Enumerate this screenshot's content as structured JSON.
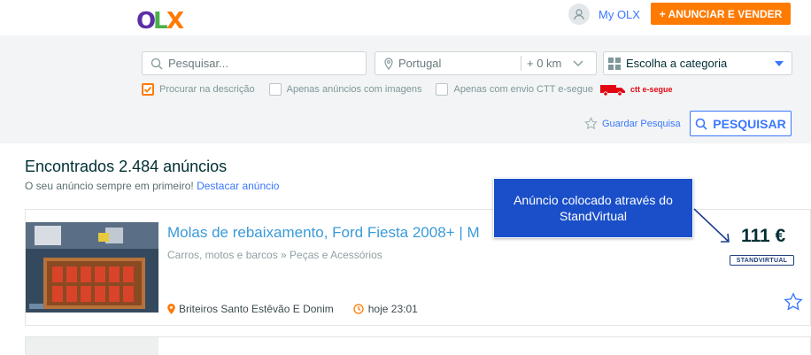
{
  "header": {
    "logo_text": "OLX",
    "myolx_label": "My OLX",
    "announce_label": "+ ANUNCIAR E VENDER"
  },
  "search": {
    "query_placeholder": "Pesquisar...",
    "location_value": "Portugal",
    "radius_value": "+ 0 km",
    "category_value": "Escolha a categoria",
    "checkbox_description": "Procurar na descrição",
    "checkbox_images": "Apenas anúncios com imagens",
    "checkbox_ctt": "Apenas com envio CTT e-segue",
    "ctt_brand": "ctt e-segue",
    "save_search_label": "Guardar Pesquisa",
    "search_button_label": "PESQUISAR"
  },
  "results": {
    "count_text": "Encontrados 2.484 anúncios",
    "promo_text": "O seu anúncio sempre em primeiro!",
    "promo_link": "Destacar anúncio"
  },
  "listing": {
    "title": "Molas de rebaixamento, Ford Fiesta 2008+ | M",
    "category": "Carros, motos e barcos » Peças e Acessórios",
    "location": "Briteiros Santo Estêvão E Donim",
    "time": "hoje 23:01",
    "price": "111 €",
    "source_logo": "STANDVIRTUAL"
  },
  "tooltip": {
    "text": "Anúncio colocado através do StandVirtual"
  },
  "colors": {
    "accent_orange": "#ff7a00",
    "link_blue": "#3a77ff",
    "tooltip_blue": "#1a4fc9"
  }
}
